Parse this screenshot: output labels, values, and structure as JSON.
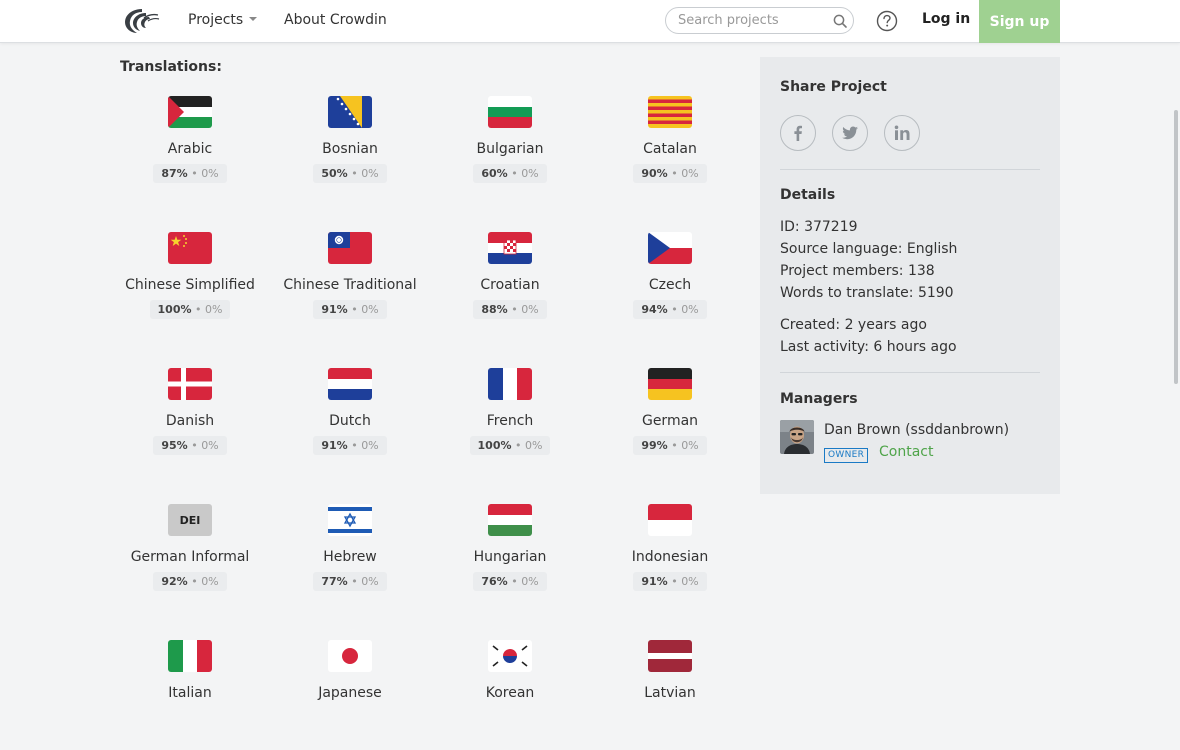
{
  "header": {
    "nav_projects": "Projects",
    "nav_about": "About Crowdin",
    "search_placeholder": "Search projects",
    "login": "Log in",
    "signup": "Sign up"
  },
  "translations": {
    "title": "Translations:",
    "languages": [
      {
        "name": "Arabic",
        "translated": "87%",
        "approved": "0%"
      },
      {
        "name": "Bosnian",
        "translated": "50%",
        "approved": "0%"
      },
      {
        "name": "Bulgarian",
        "translated": "60%",
        "approved": "0%"
      },
      {
        "name": "Catalan",
        "translated": "90%",
        "approved": "0%"
      },
      {
        "name": "Chinese Simplified",
        "translated": "100%",
        "approved": "0%"
      },
      {
        "name": "Chinese Traditional",
        "translated": "91%",
        "approved": "0%"
      },
      {
        "name": "Croatian",
        "translated": "88%",
        "approved": "0%"
      },
      {
        "name": "Czech",
        "translated": "94%",
        "approved": "0%"
      },
      {
        "name": "Danish",
        "translated": "95%",
        "approved": "0%"
      },
      {
        "name": "Dutch",
        "translated": "91%",
        "approved": "0%"
      },
      {
        "name": "French",
        "translated": "100%",
        "approved": "0%"
      },
      {
        "name": "German",
        "translated": "99%",
        "approved": "0%"
      },
      {
        "name": "German Informal",
        "translated": "92%",
        "approved": "0%",
        "flag_text": "DEI"
      },
      {
        "name": "Hebrew",
        "translated": "77%",
        "approved": "0%"
      },
      {
        "name": "Hungarian",
        "translated": "76%",
        "approved": "0%"
      },
      {
        "name": "Indonesian",
        "translated": "91%",
        "approved": "0%"
      },
      {
        "name": "Italian",
        "translated": "",
        "approved": ""
      },
      {
        "name": "Japanese",
        "translated": "",
        "approved": ""
      },
      {
        "name": "Korean",
        "translated": "",
        "approved": ""
      },
      {
        "name": "Latvian",
        "translated": "",
        "approved": ""
      }
    ]
  },
  "sidebar": {
    "share_title": "Share Project",
    "share_icons": [
      "facebook-icon",
      "twitter-icon",
      "linkedin-icon"
    ],
    "details_title": "Details",
    "id": "ID: 377219",
    "source_language": "Source language: English",
    "members": "Project members: 138",
    "words": "Words to translate: 5190",
    "created": "Created: 2 years ago",
    "last_activity": "Last activity: 6 hours ago",
    "managers_title": "Managers",
    "manager_name": "Dan Brown (ssddanbrown)",
    "owner_badge": "OWNER",
    "contact": "Contact"
  },
  "colors": {
    "signup_bg": "#9fd191",
    "contact": "#4fa44a",
    "owner_badge": "#1a7ac5",
    "sidebar_bg": "#e8eaec"
  }
}
